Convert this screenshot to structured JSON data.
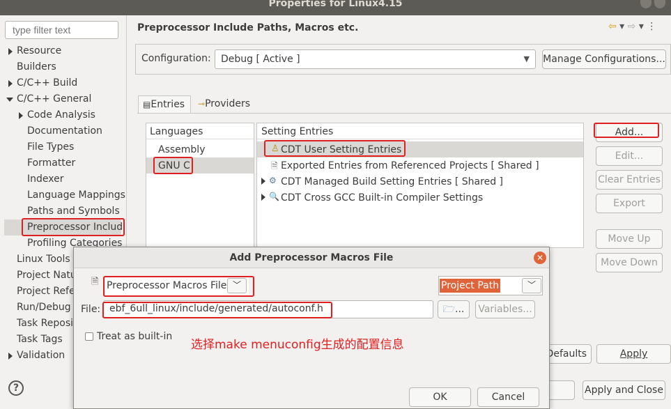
{
  "window": {
    "title": "Properties for Linux4.15"
  },
  "filter": {
    "placeholder": "type filter text"
  },
  "tree": [
    {
      "label": "Resource"
    },
    {
      "label": "Builders"
    },
    {
      "label": "C/C++ Build"
    },
    {
      "label": "C/C++ General"
    },
    {
      "label": "Code Analysis"
    },
    {
      "label": "Documentation"
    },
    {
      "label": "File Types"
    },
    {
      "label": "Formatter"
    },
    {
      "label": "Indexer"
    },
    {
      "label": "Language Mappings"
    },
    {
      "label": "Paths and Symbols"
    },
    {
      "label": "Preprocessor Includ"
    },
    {
      "label": "Profiling Categories"
    },
    {
      "label": "Linux Tools Path"
    },
    {
      "label": "Project Natu"
    },
    {
      "label": "Project Refe"
    },
    {
      "label": "Run/Debug S"
    },
    {
      "label": "Task Reposit"
    },
    {
      "label": "Task Tags"
    },
    {
      "label": "Validation"
    }
  ],
  "page": {
    "title": "Preprocessor Include Paths, Macros etc.",
    "configuration_label": "Configuration:",
    "configuration_value": "Debug  [ Active ]",
    "manage_button": "Manage Configurations...",
    "tabs": [
      {
        "label": "Entries"
      },
      {
        "label": "Providers"
      }
    ],
    "languages_header": "Languages",
    "languages": [
      "Assembly",
      "GNU C"
    ],
    "setting_entries_header": "Setting Entries",
    "entries": [
      "CDT User Setting Entries",
      "Exported Entries from Referenced Projects   [ Shared ]",
      "CDT Managed Build Setting Entries   [ Shared ]",
      "CDT Cross GCC Built-in Compiler Settings"
    ],
    "side_buttons": {
      "add": "Add...",
      "edit": "Edit...",
      "clear": "Clear Entries",
      "export": "Export",
      "move_up": "Move Up",
      "move_down": "Move Down"
    },
    "restore_defaults": "Defaults",
    "apply": "Apply",
    "apply_close": "Apply and Close",
    "help_icon": "?"
  },
  "dialog": {
    "title": "Add Preprocessor Macros File",
    "kind_value": "Preprocessor Macros File",
    "path_kind_value": "Project Path",
    "file_label": "File:",
    "file_value": "ebf_6ull_linux/include/generated/autoconf.h",
    "browse_label": "...",
    "variables_button": "Variables...",
    "builtin_label": "Treat as built-in",
    "annotation": "选择make menuconfig生成的配置信息",
    "ok": "OK",
    "cancel": "Cancel"
  },
  "colors": {
    "highlight_red": "#e02020",
    "titlebar": "#5c5b56",
    "selection": "#dad8d4"
  }
}
